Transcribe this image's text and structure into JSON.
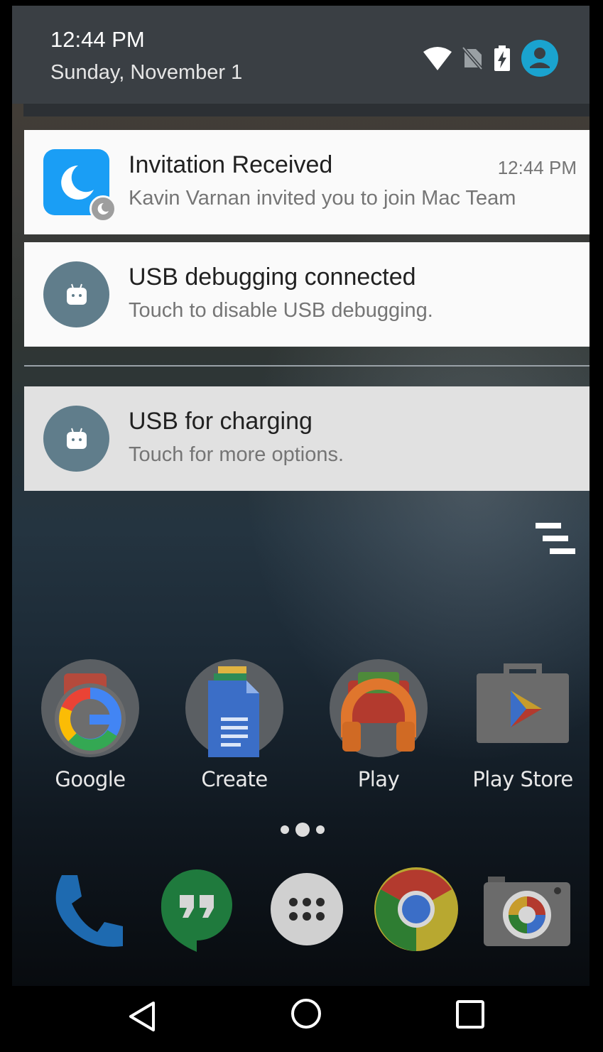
{
  "status": {
    "time": "12:44 PM",
    "date": "Sunday, November 1",
    "icons": [
      "wifi-icon",
      "no-sim-icon",
      "battery-charging-icon",
      "user-account-icon"
    ],
    "accent_color": "#1aa3cf"
  },
  "notifications": [
    {
      "icon": "moon-app-icon",
      "badge_icon": "moon-badge-icon",
      "title": "Invitation Received",
      "text": "Kavin Varnan invited you to join Mac Team",
      "time": "12:44 PM",
      "icon_color": "#1a9ef5"
    },
    {
      "icon": "android-icon",
      "title": "USB debugging connected",
      "text": "Touch to disable USB debugging.",
      "icon_color": "#607d8b"
    },
    {
      "icon": "android-icon",
      "title": "USB for charging",
      "text": "Touch for more options.",
      "icon_color": "#607d8b"
    }
  ],
  "clear_all_icon": "clear-all-icon",
  "apps": [
    {
      "label": "Google",
      "icon": "google-folder-icon"
    },
    {
      "label": "Create",
      "icon": "docs-folder-icon"
    },
    {
      "label": "Play",
      "icon": "play-folder-icon"
    },
    {
      "label": "Play Store",
      "icon": "play-store-icon"
    }
  ],
  "dock": [
    "phone-icon",
    "hangouts-icon",
    "app-drawer-icon",
    "chrome-icon",
    "camera-icon"
  ],
  "nav": [
    "back-icon",
    "home-icon",
    "recents-icon"
  ]
}
